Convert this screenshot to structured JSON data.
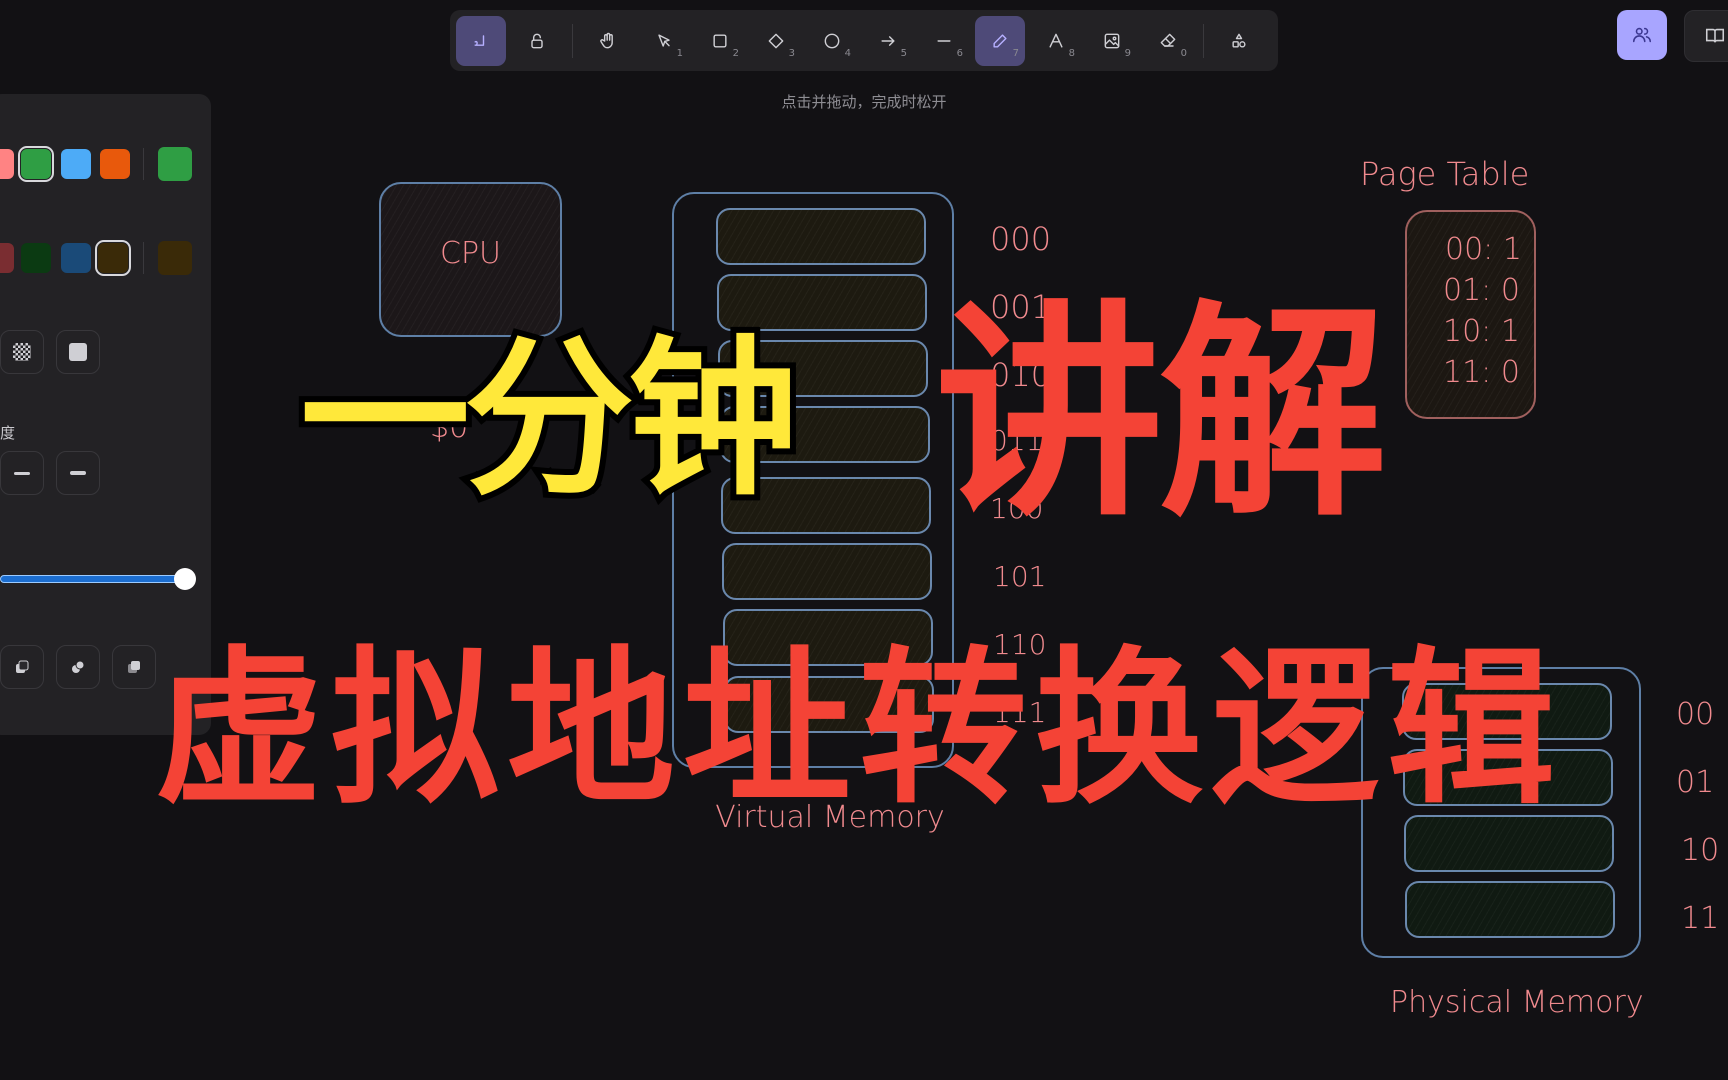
{
  "toolbar": {
    "tools": [
      {
        "name": "keep-selected-tool",
        "icon": "pencil-lock-icon",
        "key": "",
        "active": true
      },
      {
        "name": "lock",
        "icon": "unlock-icon",
        "key": "",
        "active": false
      },
      {
        "name": "hand",
        "icon": "hand-icon",
        "key": "",
        "active": false
      },
      {
        "name": "selection",
        "icon": "pointer-icon",
        "key": "1",
        "active": false
      },
      {
        "name": "rectangle",
        "icon": "square-icon",
        "key": "2",
        "active": false
      },
      {
        "name": "diamond",
        "icon": "diamond-icon",
        "key": "3",
        "active": false
      },
      {
        "name": "ellipse",
        "icon": "circle-icon",
        "key": "4",
        "active": false
      },
      {
        "name": "arrow",
        "icon": "arrow-right-icon",
        "key": "5",
        "active": false
      },
      {
        "name": "line",
        "icon": "line-icon",
        "key": "6",
        "active": false
      },
      {
        "name": "draw",
        "icon": "pencil-icon",
        "key": "7",
        "active": true
      },
      {
        "name": "text",
        "icon": "text-icon",
        "key": "8",
        "active": false
      },
      {
        "name": "image",
        "icon": "image-icon",
        "key": "9",
        "active": false
      },
      {
        "name": "eraser",
        "icon": "eraser-icon",
        "key": "0",
        "active": false
      },
      {
        "name": "more-shapes",
        "icon": "shapes-icon",
        "key": "",
        "active": false
      }
    ],
    "hint": "点击并拖动，完成时松开"
  },
  "top_right": {
    "collab_icon": "users-icon",
    "library_icon": "book-icon",
    "accent": "#a8a5ff"
  },
  "panel": {
    "stroke_colors": [
      "#ff8383",
      "#2f9e44",
      "#4dabf7",
      "#e8590c"
    ],
    "stroke_selected": "#2f9e44",
    "fill_colors": [
      "#7a2d31",
      "#0b3a12",
      "#1a4a78",
      "#3a2a08"
    ],
    "fill_selected": "#3a2a08",
    "stroke_width_label": "度",
    "opacity_percent": 100
  },
  "canvas": {
    "cpu_label": "CPU",
    "virtual_addresses": [
      "000",
      "001",
      "010",
      "011",
      "100",
      "101",
      "110",
      "111"
    ],
    "virtual_label": "Virtual Memory",
    "page_table_title": "Page Table",
    "page_table_entries": [
      "00: 1",
      "01: 0",
      "10: 1",
      "11: 0"
    ],
    "physical_addresses": [
      "00",
      "01",
      "10",
      "11"
    ],
    "physical_label": "Physical Memory",
    "stray_text": "$0"
  },
  "overlay": {
    "title_yellow": "一分钟",
    "title_red": "讲解",
    "subtitle": "虚拟地址转换逻辑"
  }
}
